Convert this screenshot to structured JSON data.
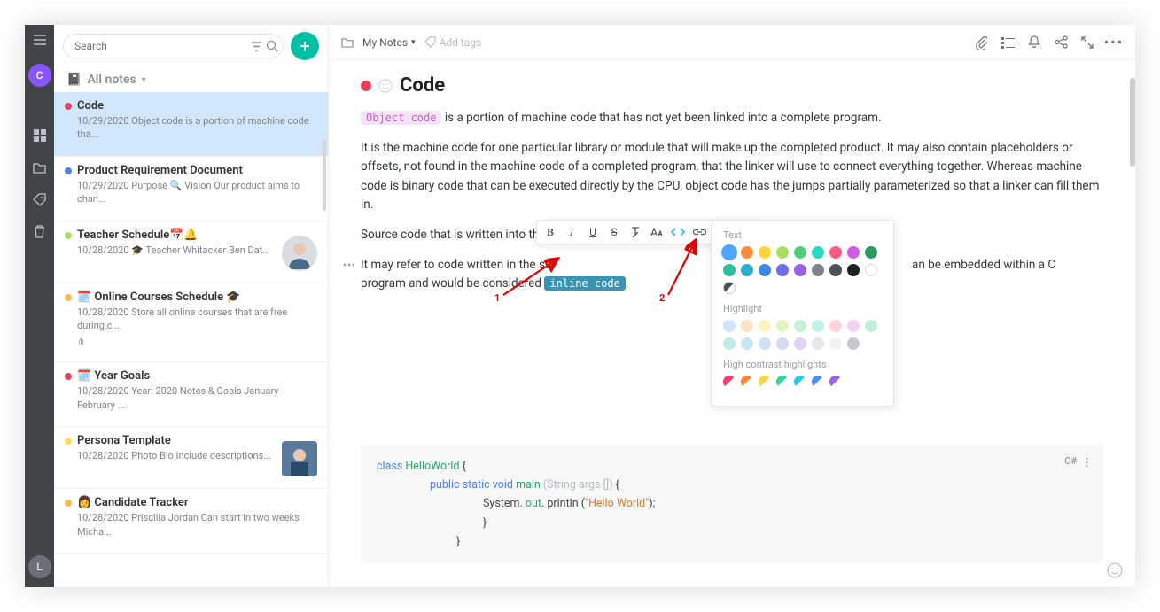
{
  "rail": {
    "avatar_letter": "C",
    "bottom_letter": "L"
  },
  "search": {
    "placeholder": "Search"
  },
  "list_header": {
    "notebook_icon": "📓",
    "title": "All notes"
  },
  "notes": [
    {
      "dot": "#e3425f",
      "title": "Code",
      "date": "10/29/2020",
      "preview": "Object code is a portion of machine code tha..."
    },
    {
      "dot": "#4f80e8",
      "title": "Product Requirement Document",
      "date": "10/29/2020",
      "preview": "Purpose 🔍 Vision Our product aims to chan..."
    },
    {
      "dot": "#a9dd66",
      "title": "Teacher Schedule📅🔔",
      "date": "10/28/2020",
      "preview": "🎓 Teacher Whitacker Ben Dat...",
      "avatar": true
    },
    {
      "dot": "#ffb84d",
      "title": "🗓️ Online Courses Schedule 🎓",
      "date": "10/28/2020",
      "preview": "Store all online courses that are free during c...",
      "share": true
    },
    {
      "dot": "#e3425f",
      "title": "🗓️ Year Goals",
      "date": "10/28/2020",
      "preview": "Year: 2020 Notes & Goals January February ..."
    },
    {
      "dot": "#ffdd55",
      "title": "Persona Template",
      "date": "10/28/2020",
      "preview": "Photo Bio Include descriptions...",
      "avatar_sq": true
    },
    {
      "dot": "#ffb84d",
      "title": "👩 Candidate Tracker",
      "date": "10/28/2020",
      "preview": "Priscilla Jordan Can start in two weeks Micha..."
    }
  ],
  "main_top": {
    "crumb": "My Notes",
    "add_tags": "Add tags"
  },
  "note": {
    "title": "Code",
    "object_code": "Object code",
    "p1_rest": "is a portion of machine code that has not yet been linked into a complete program.",
    "p2": "It is the machine code for one particular library or module that will make up the completed product. It may also contain placeholders or offsets, not found in the machine code of a completed program, that the linker will use to connect everything together. Whereas machine code is binary code that can be executed directly by the CPU, object code has the jumps partially parameterized so that a linker can fill them in.",
    "p3": "Source code that is written into the b",
    "p4_a": "It may refer to code written in the sa",
    "p4_b": "an be embedded within a C program and would be considered ",
    "inline_code": "inline code",
    "p4_c": "."
  },
  "toolbar": {
    "b": "B",
    "i": "I",
    "u": "U",
    "s": "S"
  },
  "color_popup": {
    "text_label": "Text",
    "highlight_label": "Highlight",
    "hc_label": "High contrast highlights",
    "text_colors_row1": [
      "#4da6ff",
      "#ff8a3d",
      "#ffd43d",
      "#a9dd66",
      "#4fcf7b",
      "#2bd9c2",
      "#ff5b7e",
      "#d05be3"
    ],
    "text_colors_row2": [
      "#2e9960",
      "#2bbf9b",
      "#2aaecc",
      "#3f87e5",
      "#6a6fe5",
      "#9a63e5",
      "#7d828a",
      "#4b5159"
    ],
    "text_colors_row3": [
      "#1e2124",
      "#ffffff",
      "half"
    ],
    "highlight_row1": [
      "#cfe6ff",
      "#ffe3c9",
      "#fff3c2",
      "#e1f5c2",
      "#c9f2d4",
      "#c2f0ea",
      "#ffd3de",
      "#f1d3f7"
    ],
    "highlight_row2": [
      "#c1f0d8",
      "#c2ece7",
      "#c7e6f0",
      "#cfe0f7",
      "#d6d8f5",
      "#e1d4f2",
      "#e5e7ea",
      "#f1f2f3"
    ],
    "highlight_row3": [
      "#c5c9cd"
    ],
    "hc_colors": [
      "#ff3b6b",
      "#ff8a3d",
      "#ffd43d",
      "#35d49b",
      "#2bc6e5",
      "#4d8cff",
      "#9a63e5"
    ]
  },
  "codeblock": {
    "lang": "C#",
    "l1_a": "class ",
    "l1_b": "HelloWorld",
    "l1_c": " {",
    "l2_a": "public static ",
    "l2_b": "void ",
    "l2_c": "main ",
    "l2_d": "(String args [])",
    "l2_e": " {",
    "l3_a": "System. ",
    "l3_b": "out",
    "l3_c": ". println (",
    "l3_d": "\"Hello World\"",
    "l3_e": ");",
    "l4": "}",
    "l5": "}"
  },
  "annotations": {
    "one": "1",
    "two": "2"
  }
}
